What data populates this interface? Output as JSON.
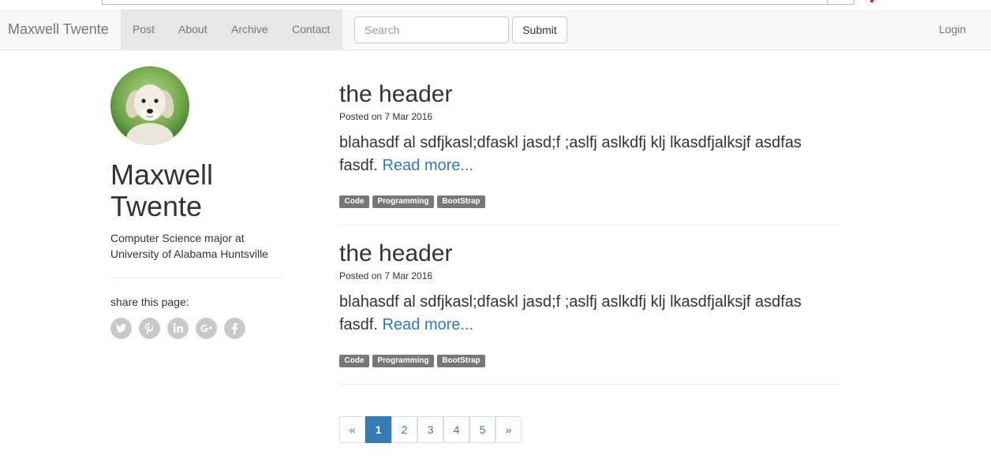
{
  "navbar": {
    "brand": "Maxwell Twente",
    "links": [
      "Post",
      "About",
      "Archive",
      "Contact"
    ],
    "search_placeholder": "Search",
    "submit_label": "Submit",
    "login_label": "Login"
  },
  "sidebar": {
    "name": "Maxwell Twente",
    "bio": "Computer Science major at University of Alabama Huntsville",
    "share_label": "share this page:",
    "social_icons": [
      "twitter-icon",
      "pinterest-icon",
      "linkedin-icon",
      "google-plus-icon",
      "facebook-icon"
    ]
  },
  "posts": [
    {
      "title": "the header",
      "meta": "Posted on 7 Mar 2016",
      "body": "blahasdf al sdfjkasl;dfaskl jasd;f ;aslfj aslkdfj klj lkasdfjalksjf asdfas fasdf. ",
      "read_more": "Read more...",
      "tags": [
        "Code",
        "Programming",
        "BootStrap"
      ]
    },
    {
      "title": "the header",
      "meta": "Posted on 7 Mar 2016",
      "body": "blahasdf al sdfjkasl;dfaskl jasd;f ;aslfj aslkdfj klj lkasdfjalksjf asdfas fasdf. ",
      "read_more": "Read more...",
      "tags": [
        "Code",
        "Programming",
        "BootStrap"
      ]
    }
  ],
  "pagination": {
    "prev": "«",
    "pages": [
      "1",
      "2",
      "3",
      "4",
      "5"
    ],
    "next": "»",
    "current": "1"
  },
  "colors": {
    "link": "#337ab7",
    "tag_bg": "#777777",
    "navbar_bg": "#f8f8f8"
  }
}
